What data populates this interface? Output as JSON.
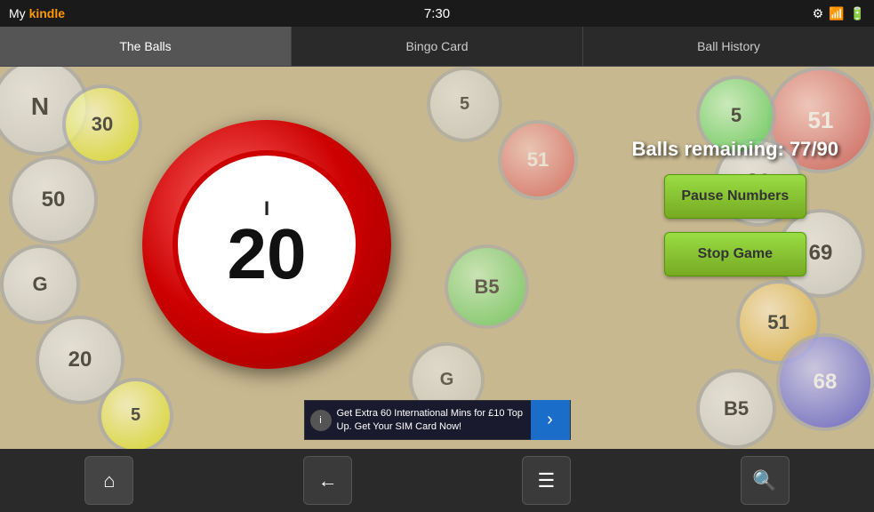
{
  "statusBar": {
    "appLabel": "My ",
    "appName": "kindle",
    "time": "7:30"
  },
  "tabs": [
    {
      "id": "the-balls",
      "label": "The Balls",
      "active": true
    },
    {
      "id": "bingo-card",
      "label": "Bingo Card",
      "active": false
    },
    {
      "id": "ball-history",
      "label": "Ball History",
      "active": false
    }
  ],
  "game": {
    "ballLetter": "I",
    "ballNumber": "20",
    "ballsRemainingLabel": "Balls remaining:",
    "ballsRemaining": "77/90",
    "pauseButton": "Pause Numbers",
    "stopButton": "Stop Game"
  },
  "ad": {
    "text": "Get Extra 60 International Mins for £10 Top Up. Get Your SIM Card Now!",
    "infoIcon": "i"
  },
  "nav": {
    "homeIcon": "⌂",
    "backIcon": "←",
    "menuIcon": "☰",
    "searchIcon": "🔍"
  }
}
